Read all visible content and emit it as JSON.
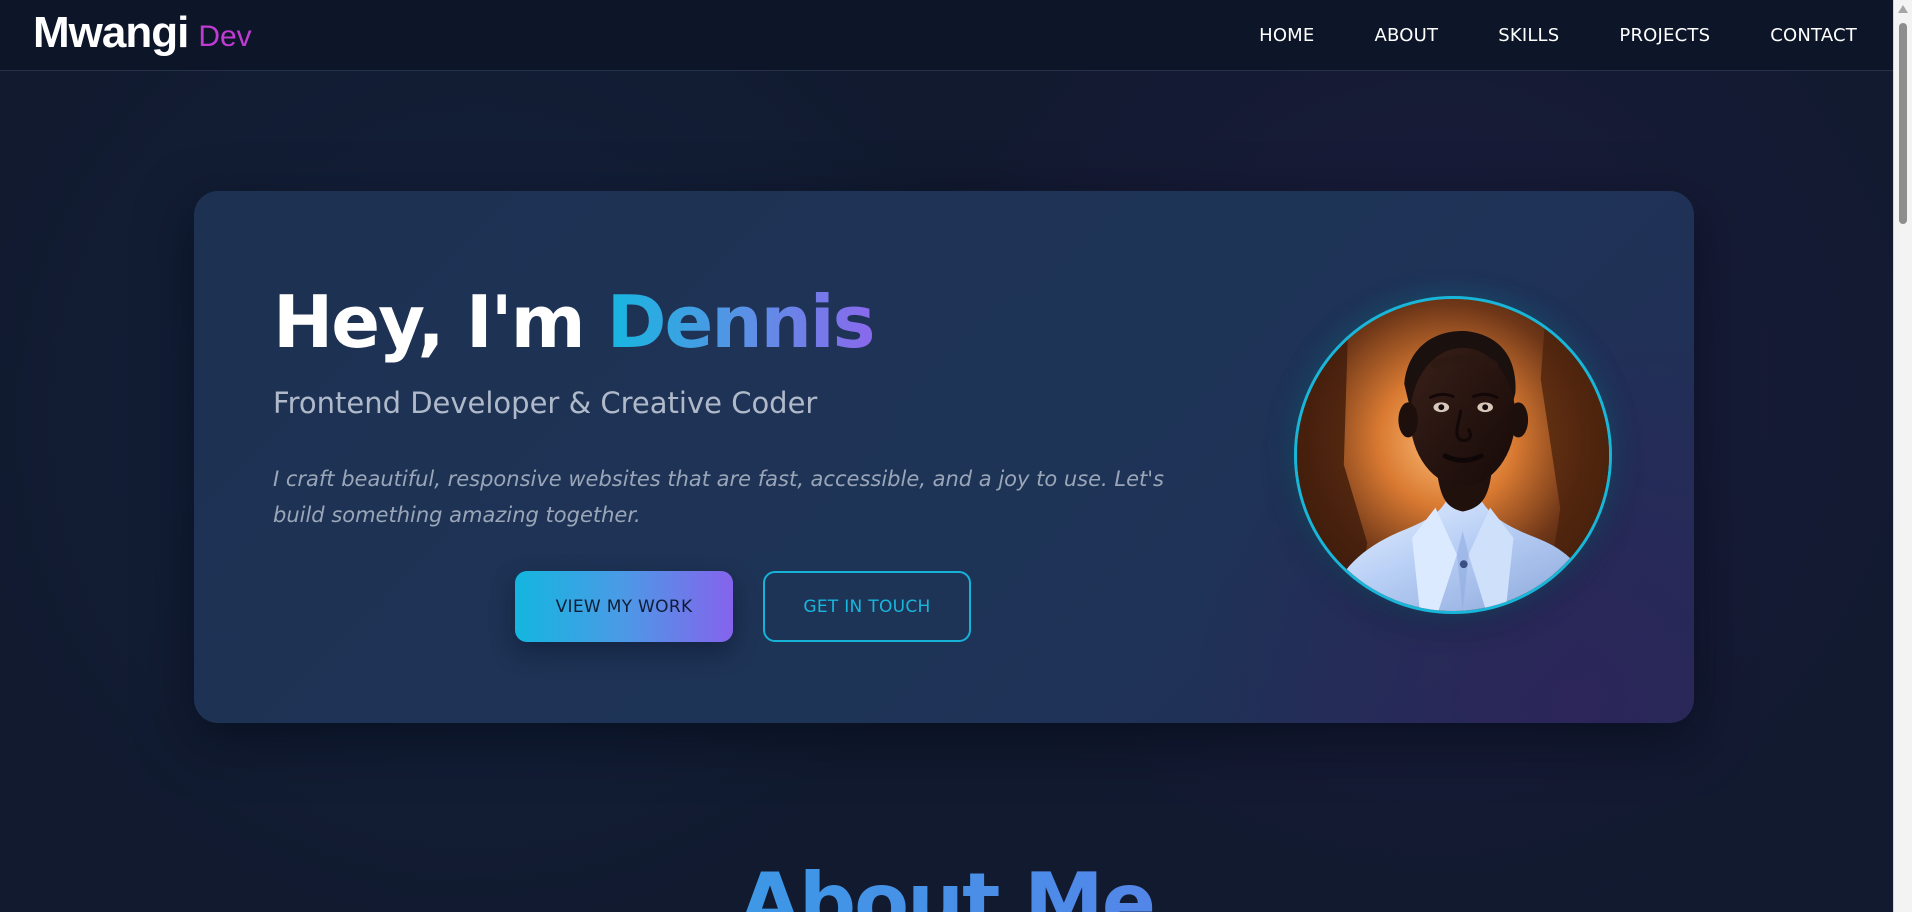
{
  "brand": {
    "name": "Mwangi",
    "suffix": "Dev",
    "suffix_color": "#c03bd4"
  },
  "nav": {
    "items": [
      "HOME",
      "ABOUT",
      "SKILLS",
      "PROJECTS",
      "CONTACT"
    ]
  },
  "hero": {
    "greeting": "Hey, I'm ",
    "name": "Dennis",
    "subtitle": "Frontend Developer & Creative Coder",
    "bio": "I craft beautiful, responsive websites that are fast, accessible, and a joy to use. Let's build something amazing together.",
    "primary_button": "VIEW MY WORK",
    "secondary_button": "GET IN TOUCH",
    "accent_colors": [
      "#16b7df",
      "#7a64ec"
    ]
  },
  "sections": {
    "about_title": "About Me"
  },
  "icons": {
    "profile_photo": "profile-photo"
  }
}
